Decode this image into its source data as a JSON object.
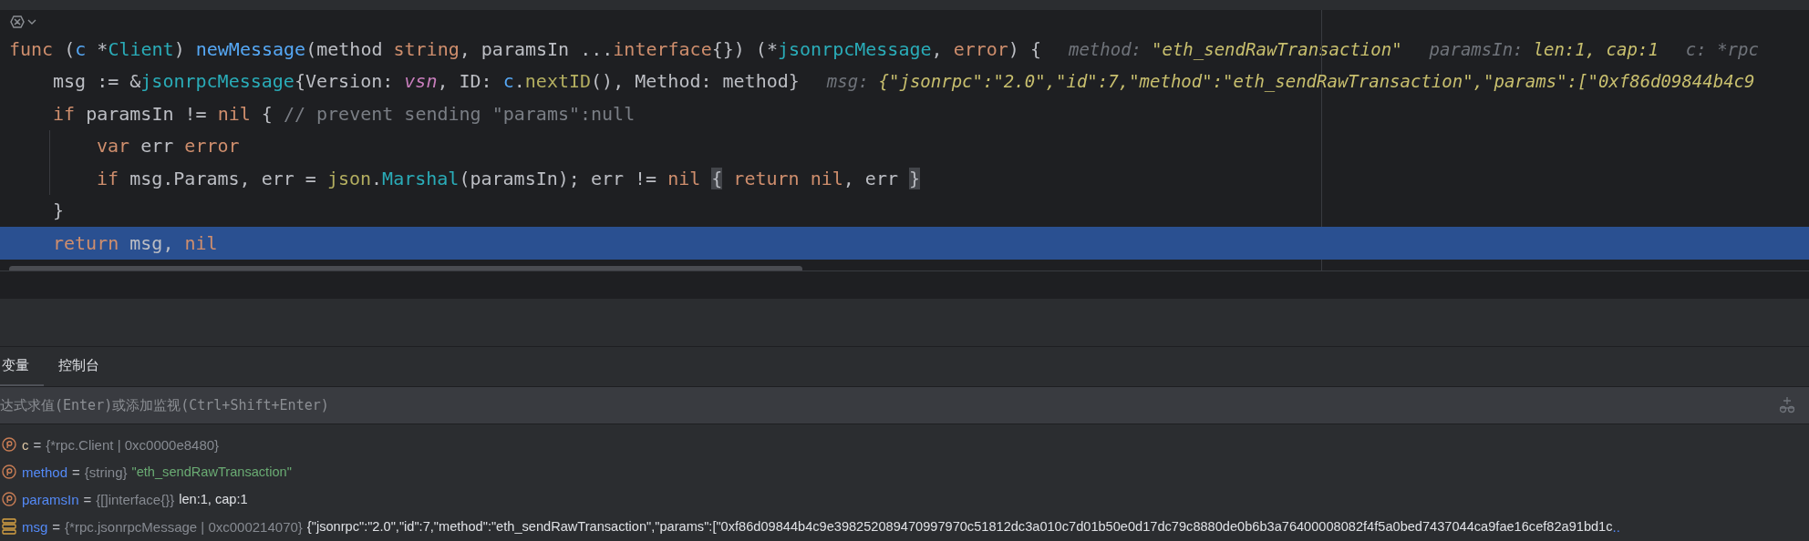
{
  "editor": {
    "lines": [
      {
        "selected": false,
        "tokens": [
          {
            "kind": "kw",
            "text": "func"
          },
          {
            "kind": "plain",
            "text": " ("
          },
          {
            "kind": "param",
            "text": "c"
          },
          {
            "kind": "plain",
            "text": " *"
          },
          {
            "kind": "type",
            "text": "Client"
          },
          {
            "kind": "plain",
            "text": ") "
          },
          {
            "kind": "fn",
            "text": "newMessage"
          },
          {
            "kind": "plain",
            "text": "(method "
          },
          {
            "kind": "kw",
            "text": "string"
          },
          {
            "kind": "plain",
            "text": ", paramsIn ..."
          },
          {
            "kind": "kw",
            "text": "interface"
          },
          {
            "kind": "plain",
            "text": "{}) (*"
          },
          {
            "kind": "type",
            "text": "jsonrpcMessage"
          },
          {
            "kind": "plain",
            "text": ", "
          },
          {
            "kind": "kw",
            "text": "error"
          },
          {
            "kind": "plain",
            "text": ") {"
          }
        ],
        "hints": [
          {
            "label": "method:",
            "value": "\"eth_sendRawTransaction\""
          },
          {
            "label": "paramsIn:",
            "value": "len:1, cap:1"
          },
          {
            "label": "c: *rpc"
          }
        ],
        "children": [
          {
            "selected": false,
            "tokens": [
              {
                "kind": "plain",
                "text": "msg := &"
              },
              {
                "kind": "type",
                "text": "jsonrpcMessage"
              },
              {
                "kind": "plain",
                "text": "{Version: "
              },
              {
                "kind": "const",
                "text": "vsn"
              },
              {
                "kind": "plain",
                "text": ", ID: "
              },
              {
                "kind": "param",
                "text": "c"
              },
              {
                "kind": "plain",
                "text": "."
              },
              {
                "kind": "call",
                "text": "nextID"
              },
              {
                "kind": "plain",
                "text": "(), Method: method}"
              }
            ],
            "hints": [
              {
                "label": "msg:",
                "value": "{\"jsonrpc\":\"2.0\",\"id\":7,\"method\":\"eth_sendRawTransaction\",\"params\":[\"0xf86d09844b4c9"
              }
            ]
          },
          {
            "selected": false,
            "tokens": [
              {
                "kind": "kw",
                "text": "if"
              },
              {
                "kind": "plain",
                "text": " paramsIn != "
              },
              {
                "kind": "kw",
                "text": "nil"
              },
              {
                "kind": "plain",
                "text": " { "
              },
              {
                "kind": "comment",
                "text": "// prevent sending \"params\":null"
              }
            ],
            "children": [
              {
                "selected": false,
                "tokens": [
                  {
                    "kind": "kw",
                    "text": "var"
                  },
                  {
                    "kind": "plain",
                    "text": " err "
                  },
                  {
                    "kind": "kw",
                    "text": "error"
                  }
                ]
              },
              {
                "selected": false,
                "tokens": [
                  {
                    "kind": "kw",
                    "text": "if"
                  },
                  {
                    "kind": "plain",
                    "text": " msg.Params, err = "
                  },
                  {
                    "kind": "pkg",
                    "text": "json"
                  },
                  {
                    "kind": "plain",
                    "text": "."
                  },
                  {
                    "kind": "method",
                    "text": "Marshal"
                  },
                  {
                    "kind": "plain",
                    "text": "(paramsIn); err != "
                  },
                  {
                    "kind": "kw",
                    "text": "nil"
                  },
                  {
                    "kind": "brace",
                    "text": "{"
                  },
                  {
                    "kind": "kw",
                    "text": "return"
                  },
                  {
                    "kind": "kw",
                    "text": " nil"
                  },
                  {
                    "kind": "plain",
                    "text": ", err"
                  },
                  {
                    "kind": "brace",
                    "text": "}"
                  }
                ]
              }
            ]
          },
          {
            "selected": false,
            "tokens": [
              {
                "kind": "plain",
                "text": "}"
              }
            ]
          },
          {
            "selected": true,
            "tokens": [
              {
                "kind": "kw",
                "text": "return"
              },
              {
                "kind": "plain",
                "text": " msg, "
              },
              {
                "kind": "kw",
                "text": "nil"
              }
            ]
          }
        ]
      }
    ]
  },
  "debugger": {
    "tabs": [
      {
        "label": "变量",
        "selected": true
      },
      {
        "label": "控制台",
        "selected": false
      }
    ],
    "evaluate": {
      "placeholder": "达式求值(Enter)或添加监视(Ctrl+Shift+Enter)"
    },
    "variables": [
      {
        "kind": "receiver",
        "name": "c",
        "equals": "=",
        "type": "{*rpc.Client | 0xc0000e8480}"
      },
      {
        "kind": "param",
        "name": "method",
        "equals": "=",
        "type": "{string}",
        "value": {
          "kind": "string",
          "text": "\"eth_sendRawTransaction\""
        }
      },
      {
        "kind": "param",
        "name": "paramsIn",
        "equals": "=",
        "type": "{[]interface{}}",
        "value": {
          "kind": "plain",
          "text": "len:1, cap:1"
        }
      },
      {
        "kind": "local",
        "name": "msg",
        "equals": "=",
        "type": "{*rpc.jsonrpcMessage | 0xc000214070}",
        "value": {
          "kind": "plain",
          "text": "{\"jsonrpc\":\"2.0\",\"id\":7,\"method\":\"eth_sendRawTransaction\",\"params\":[\"0xf86d09844b4c9e398252089470997970c51812dc3a010c7d01b50e0d17dc79c8880de0b6b3a76400008082f4f5a0bed7437044ca9fae16cef82a91bd1c"
        },
        "more": ".."
      }
    ]
  }
}
